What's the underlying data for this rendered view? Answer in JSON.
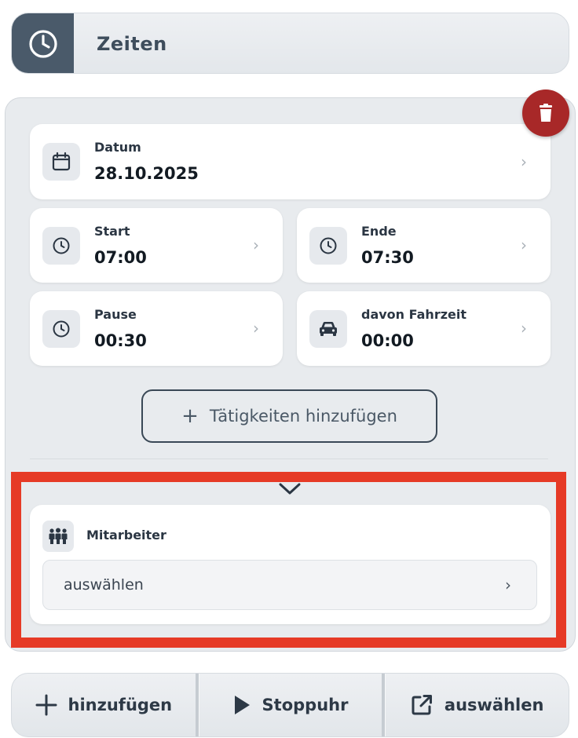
{
  "header": {
    "title": "Zeiten",
    "icon": "clock-icon"
  },
  "delete": {
    "icon": "trash-icon",
    "color": "#a82828"
  },
  "fields": {
    "date": {
      "label": "Datum",
      "value": "28.10.2025",
      "icon": "calendar-icon"
    },
    "start": {
      "label": "Start",
      "value": "07:00",
      "icon": "clock-icon"
    },
    "end": {
      "label": "Ende",
      "value": "07:30",
      "icon": "clock-icon"
    },
    "pause": {
      "label": "Pause",
      "value": "00:30",
      "icon": "clock-icon"
    },
    "travel": {
      "label": "davon Fahrzeit",
      "value": "00:00",
      "icon": "car-icon"
    }
  },
  "chevron": "›",
  "add_activity": {
    "plus": "+",
    "label": "Tätigkeiten hinzufügen"
  },
  "employees": {
    "label": "Mitarbeiter",
    "select_value": "auswählen",
    "icon": "people-icon"
  },
  "highlight_color": "#e63a26",
  "bottom_bar": {
    "add": {
      "label": "hinzufügen",
      "icon": "plus-icon"
    },
    "stopwatch": {
      "label": "Stoppuhr",
      "icon": "play-icon"
    },
    "select": {
      "label": "auswählen",
      "icon": "external-link-icon"
    }
  }
}
